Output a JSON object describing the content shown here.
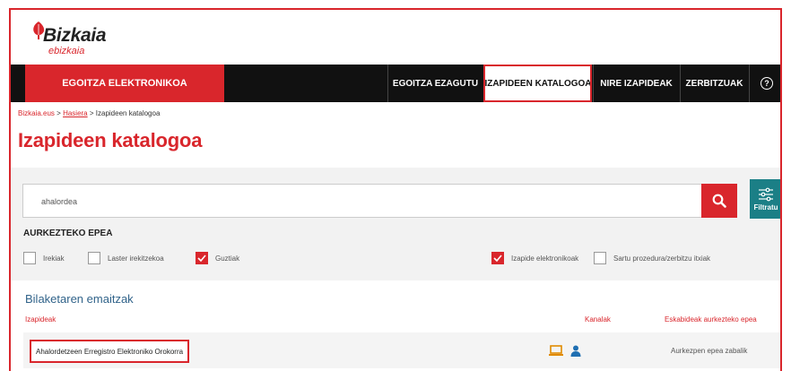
{
  "logo": {
    "title": "Bizkaia",
    "subtitle": "ebizkaia"
  },
  "nav": {
    "primary": "EGOITZA ELEKTRONIKOA",
    "items": [
      "EGOITZA EZAGUTU",
      "IZAPIDEEN KATALOGOA",
      "NIRE IZAPIDEAK",
      "ZERBITZUAK"
    ],
    "active": "IZAPIDEEN KATALOGOA",
    "help": "?"
  },
  "breadcrumb": {
    "home": "Bizkaia.eus",
    "sep": ">",
    "link": "Hasiera",
    "current": "Izapideen katalogoa"
  },
  "page_title": "Izapideen katalogoa",
  "search": {
    "value": "ahalordea",
    "filter_label": "Filtratu"
  },
  "filters": {
    "section_label": "AURKEZTEKO EPEA",
    "options": [
      {
        "label": "Irekiak",
        "checked": false
      },
      {
        "label": "Laster irekitzekoa",
        "checked": false
      },
      {
        "label": "Guztiak",
        "checked": true
      },
      {
        "label": "Izapide elektronikoak",
        "checked": true
      },
      {
        "label": "Sartu prozedura/zerbitzu itxiak",
        "checked": false
      }
    ]
  },
  "results": {
    "title": "Bilaketaren emaitzak",
    "columns": [
      "Izapideak",
      "Kanalak",
      "Eskabideak aurkezteko epea"
    ],
    "rows": [
      {
        "name": "Ahalordetzeen Erregistro Elektroniko Orokorra",
        "channels": [
          "laptop-icon",
          "person-icon"
        ],
        "status": "Aurkezpen epea zabalik"
      }
    ]
  },
  "colors": {
    "brand_red": "#d9262c",
    "nav_bg": "#111111",
    "filter_teal": "#1b7f86",
    "results_blue": "#31638a",
    "channel_orange": "#e08a00",
    "channel_blue": "#1f6fb2"
  }
}
